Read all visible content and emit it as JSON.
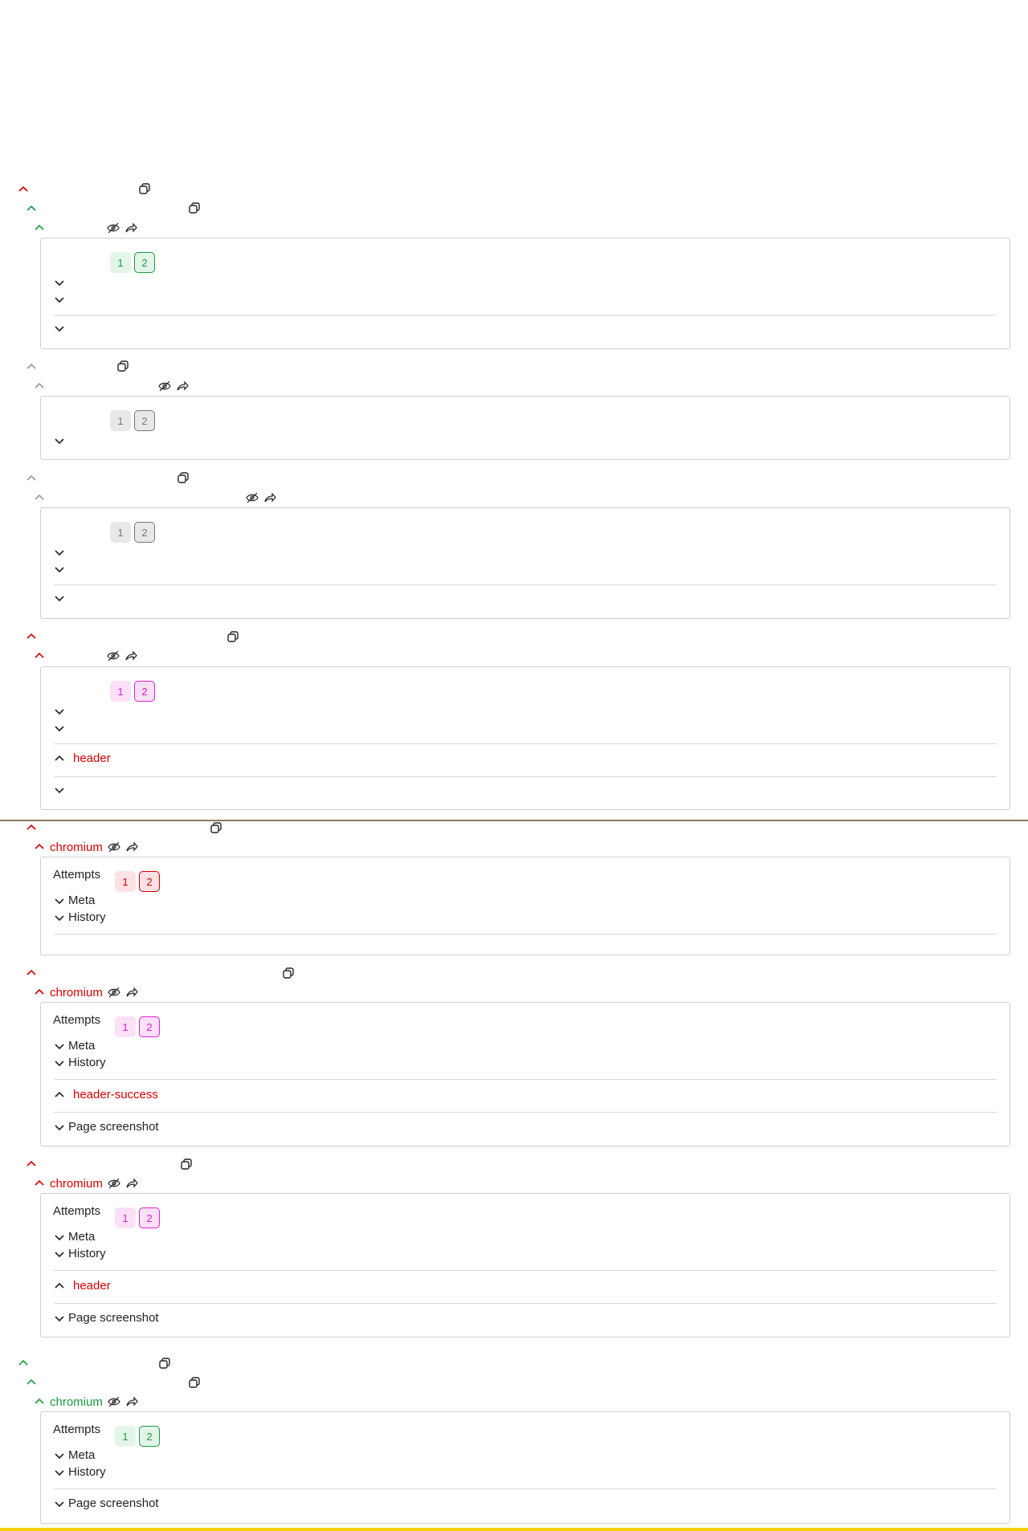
{
  "colors": {
    "fail": "#d40000",
    "success": "#1a9c3c",
    "skipped": "#9a9a9a",
    "error": "#e01ed0",
    "divider_brown": "#8b7d62",
    "divider_yellow": "#f7cf0f"
  },
  "labels": {
    "attempts": "Attempts",
    "meta": "Meta",
    "history": "History",
    "page_screenshot": "Page screenshot",
    "attempt_1": "1",
    "attempt_2": "2"
  },
  "browsers": {
    "b5": "chromium",
    "b6": "chromium",
    "b7": "chromium",
    "b8": "chromium"
  },
  "states": {
    "s4": "header",
    "s6": "header-success",
    "s7": "header"
  },
  "icons": {
    "expand": "chevron-up-icon",
    "collapse": "chevron-down-icon",
    "copy": "copy-icon",
    "hide": "eye-crossed-icon",
    "share": "share-arrow-icon"
  }
}
